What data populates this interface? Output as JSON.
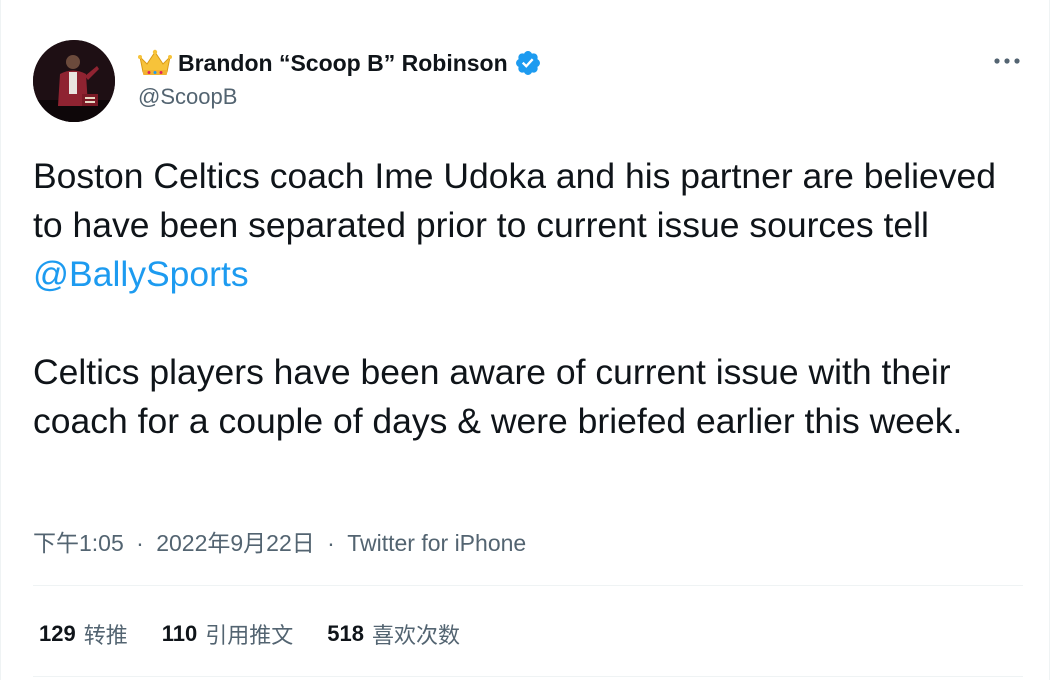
{
  "author": {
    "name": "Brandon “Scoop B” Robinson",
    "handle": "@ScoopB",
    "crown_icon": "crown-emoji-icon",
    "verified_icon": "verified-badge-icon"
  },
  "tweet": {
    "paragraph1_text": "Boston Celtics coach Ime Udoka and his partner are believed to have been separated prior to current issue sources tell ",
    "mention": "@BallySports",
    "paragraph2_text": "Celtics players have been aware of current issue with their coach for a couple of days & were briefed earlier this week."
  },
  "meta": {
    "time": "下午1:05",
    "separator": "·",
    "date": "2022年9月22日",
    "source": "Twitter for iPhone"
  },
  "stats": {
    "retweets_count": "129",
    "retweets_label": "转推",
    "quotes_count": "110",
    "quotes_label": "引用推文",
    "likes_count": "518",
    "likes_label": "喜欢次数"
  },
  "colors": {
    "text": "#0f1419",
    "secondary": "#536471",
    "link": "#1d9bf0",
    "verified": "#1d9bf0",
    "divider": "#eff3f4"
  }
}
